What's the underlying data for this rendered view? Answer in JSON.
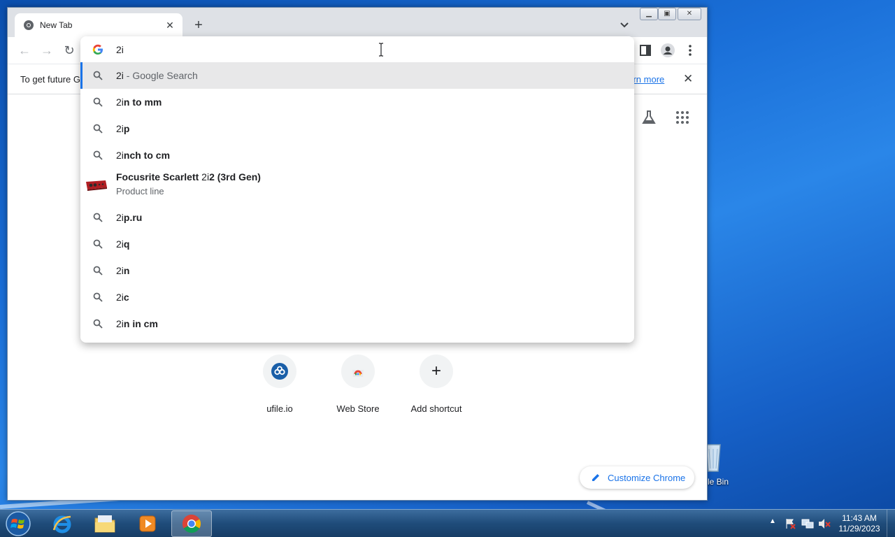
{
  "browser": {
    "tab": {
      "title": "New Tab"
    },
    "address": {
      "value": "2i"
    },
    "infobar": {
      "message": "To get future G",
      "learn_more": "earn more"
    }
  },
  "omnibox": {
    "suggestions": [
      {
        "prefix": "2i",
        "rest": " - Google Search",
        "icon": "search-icon",
        "selected": true
      },
      {
        "prefix": "2i",
        "rest": "n to mm",
        "icon": "search-icon"
      },
      {
        "prefix": "2i",
        "rest": "p",
        "icon": "search-icon"
      },
      {
        "prefix": "2i",
        "rest": "nch to cm",
        "icon": "search-icon"
      },
      {
        "entity_title_a": "Focusrite Scarlett ",
        "entity_title_b": "2i",
        "entity_title_c": "2 (3rd Gen)",
        "entity_subtitle": "Product line",
        "icon": "product-thumbnail"
      },
      {
        "prefix": "2i",
        "rest": "p.ru",
        "icon": "search-icon"
      },
      {
        "prefix": "2i",
        "rest": "q",
        "icon": "search-icon"
      },
      {
        "prefix": "2i",
        "rest": "n",
        "icon": "search-icon"
      },
      {
        "prefix": "2i",
        "rest": "c",
        "icon": "search-icon"
      },
      {
        "prefix": "2i",
        "rest": "n in cm",
        "icon": "search-icon"
      }
    ]
  },
  "ntp": {
    "shortcuts": [
      {
        "label": "ufile.io",
        "icon": "ufile-icon"
      },
      {
        "label": "Web Store",
        "icon": "web-store-icon"
      },
      {
        "label": "Add shortcut",
        "icon": "plus-icon"
      }
    ],
    "customize_label": "Customize Chrome"
  },
  "desktop": {
    "recycle_bin_label": "le Bin"
  },
  "taskbar": {
    "apps": [
      "internet-explorer-icon",
      "file-explorer-icon",
      "media-player-icon",
      "chrome-icon"
    ],
    "clock_time": "11:43 AM",
    "clock_date": "11/29/2023"
  },
  "colors": {
    "accent": "#1a73e8",
    "taskbar": "#1f4c7a",
    "desktop": "#1a6fd8"
  }
}
